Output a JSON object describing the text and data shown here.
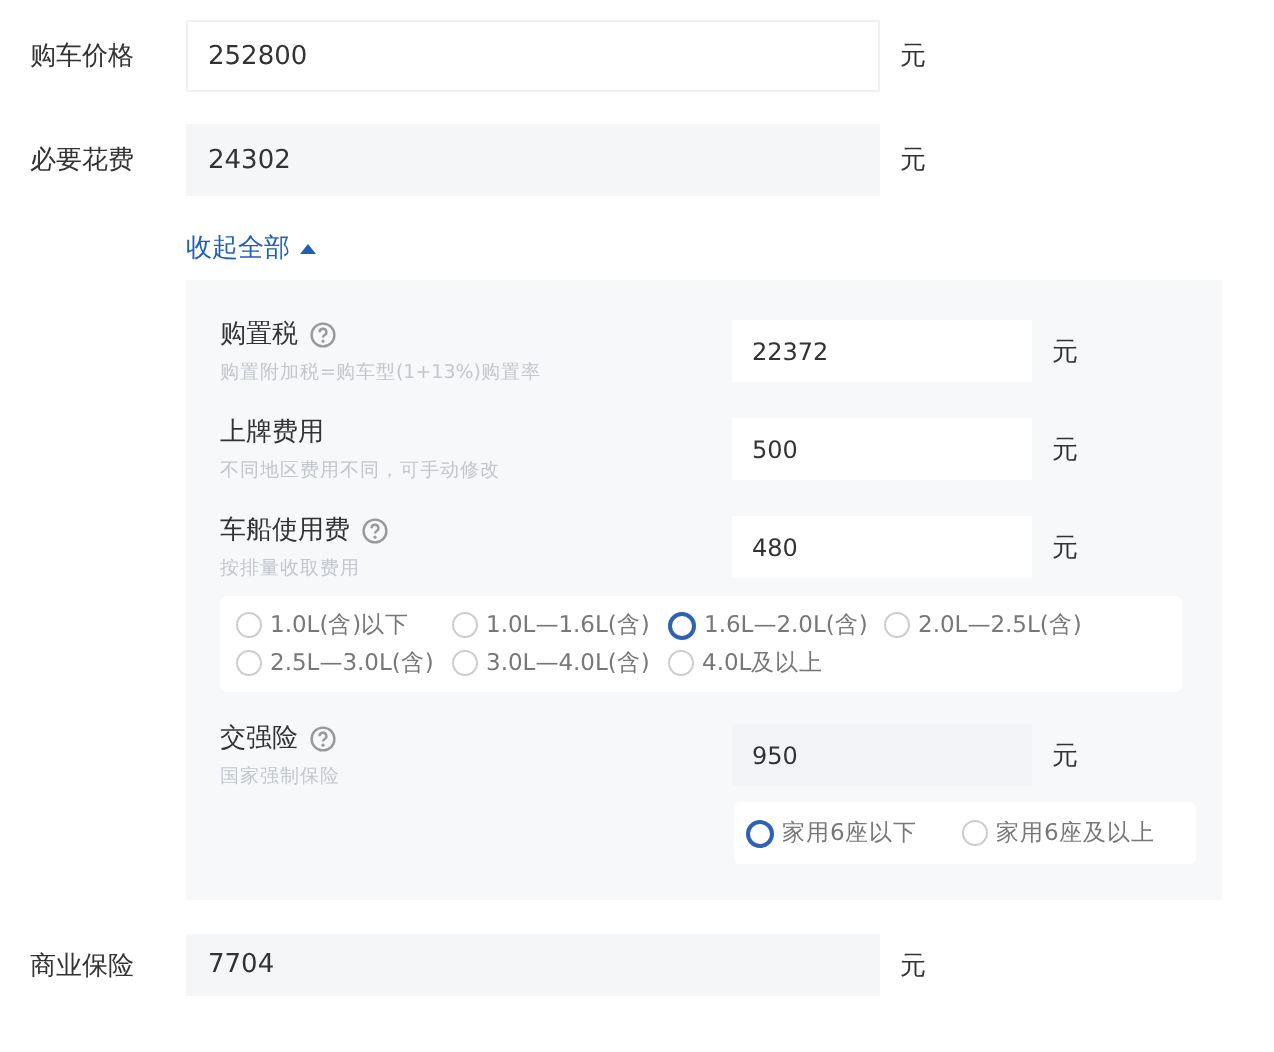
{
  "top_fields": [
    {
      "label": "购车价格",
      "value": "252800",
      "unit": "元",
      "kind": "plain"
    },
    {
      "label": "必要花费",
      "value": "24302",
      "unit": "元",
      "kind": "shaded"
    }
  ],
  "toggle": {
    "label": "收起全部",
    "expanded": true
  },
  "panel_items": [
    {
      "label": "购置税",
      "help": true,
      "hint": "购置附加税=购车型(1+13%)购置率",
      "value": "22372",
      "unit": "元",
      "kind": "plain"
    },
    {
      "label": "上牌费用",
      "help": false,
      "hint": "不同地区费用不同，可手动修改",
      "value": "500",
      "unit": "元",
      "kind": "plain"
    },
    {
      "label": "车船使用费",
      "help": true,
      "hint": "按排量收取费用",
      "value": "480",
      "unit": "元",
      "kind": "plain",
      "options": [
        {
          "label": "1.0L(含)以下",
          "selected": false
        },
        {
          "label": "1.0L—1.6L(含)",
          "selected": false
        },
        {
          "label": "1.6L—2.0L(含)",
          "selected": true
        },
        {
          "label": "2.0L—2.5L(含)",
          "selected": false
        },
        {
          "label": "2.5L—3.0L(含)",
          "selected": false
        },
        {
          "label": "3.0L—4.0L(含)",
          "selected": false
        },
        {
          "label": "4.0L及以上",
          "selected": false
        }
      ]
    },
    {
      "label": "交强险",
      "help": true,
      "hint": "国家强制保险",
      "value": "950",
      "unit": "元",
      "kind": "shaded",
      "options": [
        {
          "label": "家用6座以下",
          "selected": true
        },
        {
          "label": "家用6座及以上",
          "selected": false
        }
      ]
    }
  ],
  "bottom_fields": [
    {
      "label": "商业保险",
      "value": "7704",
      "unit": "元",
      "kind": "shaded"
    }
  ]
}
